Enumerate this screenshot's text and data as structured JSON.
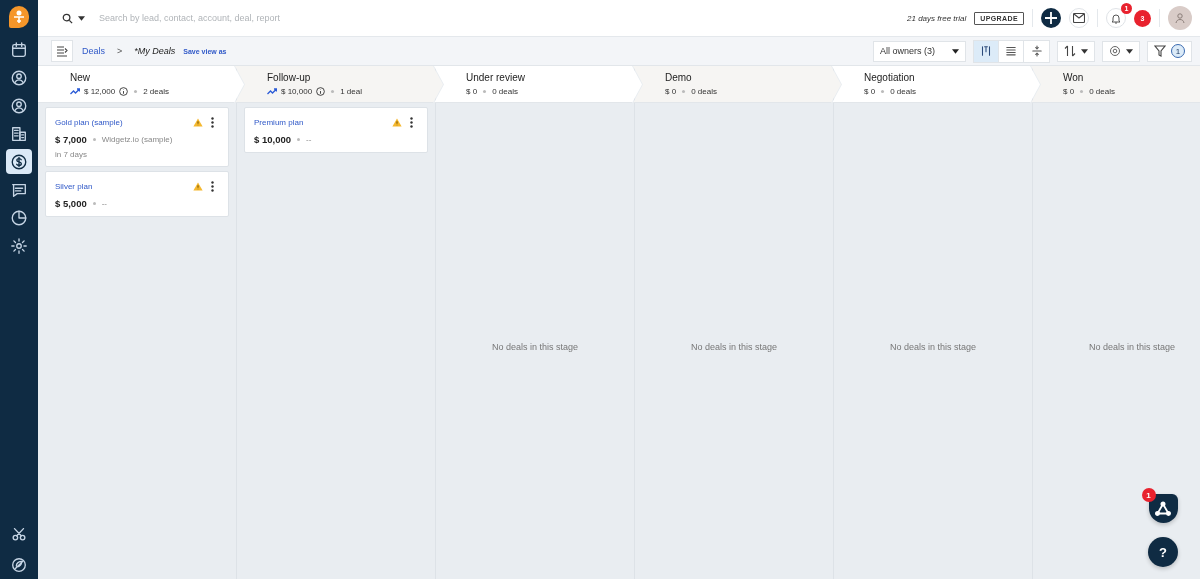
{
  "sidebar": {
    "items": [
      {
        "selected": false
      },
      {
        "selected": false
      },
      {
        "selected": false
      },
      {
        "selected": false
      },
      {
        "selected": true
      },
      {
        "selected": false
      },
      {
        "selected": false
      },
      {
        "selected": false
      }
    ],
    "bottom_items": [
      {
        "selected": false
      },
      {
        "selected": false
      }
    ]
  },
  "top_bar": {
    "search": {
      "placeholder": "Search by lead, contact, account, deal, report"
    },
    "trial_text": "21 days free trial",
    "upgrade_button": "UPGRADE",
    "notification_badge": "1",
    "alert_count": "3"
  },
  "sub_bar": {
    "breadcrumb": "Deals",
    "separator": ">",
    "view_name": "*My Deals",
    "save_view": "Save view as",
    "owner_filter": "All owners (3)",
    "view_modes": [
      {
        "selected": true
      },
      {
        "selected": false
      },
      {
        "selected": false
      }
    ],
    "filter_count": "1"
  },
  "stages": [
    {
      "name": "New",
      "amount": "$ 12,000",
      "count": "2 deals",
      "trend": true,
      "deals": [
        {
          "title": "Gold plan (sample)",
          "amount": "$ 7,000",
          "company": "Widgetz.io (sample)",
          "due": "in 7 days",
          "warning": true
        },
        {
          "title": "Silver plan",
          "amount": "$ 5,000",
          "company": "--",
          "warning": true
        }
      ]
    },
    {
      "name": "Follow-up",
      "amount": "$ 10,000",
      "count": "1 deal",
      "trend": true,
      "deals": [
        {
          "title": "Premium plan",
          "amount": "$ 10,000",
          "company": "--",
          "warning": true
        }
      ]
    },
    {
      "name": "Under review",
      "amount": "$ 0",
      "count": "0 deals",
      "trend": false,
      "empty_text": "No deals in this stage"
    },
    {
      "name": "Demo",
      "amount": "$ 0",
      "count": "0 deals",
      "trend": false,
      "empty_text": "No deals in this stage"
    },
    {
      "name": "Negotiation",
      "amount": "$ 0",
      "count": "0 deals",
      "trend": false,
      "empty_text": "No deals in this stage"
    },
    {
      "name": "Won",
      "amount": "$ 0",
      "count": "0 deals",
      "trend": false,
      "empty_text": "No deals in this stage"
    }
  ],
  "floating": {
    "badge": "1",
    "help": "?"
  }
}
